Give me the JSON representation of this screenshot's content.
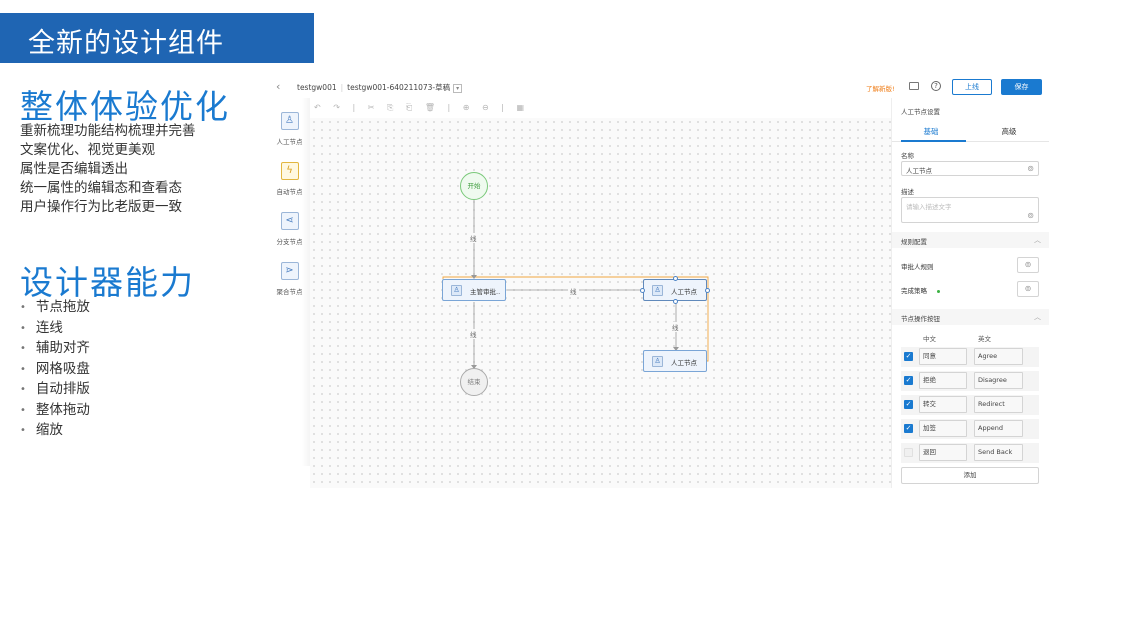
{
  "banner": {
    "title": "全新的设计组件"
  },
  "section1": {
    "heading": "整体体验优化",
    "lines": [
      "重新梳理功能结构梳理并完善",
      "文案优化、视觉更美观",
      "属性是否编辑透出",
      "统一属性的编辑态和查看态",
      "用户操作行为比老版更一致"
    ]
  },
  "section2": {
    "heading": "设计器能力",
    "bullets": [
      "节点拖放",
      "连线",
      "辅助对齐",
      "网格吸盘",
      "自动排版",
      "整体拖动",
      "缩放"
    ]
  },
  "app": {
    "breadcrumb": {
      "project": "testgw001",
      "flow": "testgw001-640211073-草稿"
    },
    "learn_new": "了解新版!",
    "online_label": "上线",
    "save_label": "保存",
    "palette": [
      {
        "label": "人工节点",
        "icon": "person-icon",
        "glyph": "♙"
      },
      {
        "label": "自动节点",
        "icon": "lightning-icon",
        "glyph": "⚡"
      },
      {
        "label": "分支节点",
        "icon": "branch-icon",
        "glyph": "⊰"
      },
      {
        "label": "聚合节点",
        "icon": "merge-icon",
        "glyph": "⊱"
      }
    ],
    "canvas_toolbar": "↶ ↷ | ✂ ⎘ ⎗ 🗑 | ⊕ ⊖ | ▦",
    "nodes": {
      "start": "开始",
      "end": "结束",
      "manager": "主管审批..",
      "manual1": "人工节点",
      "manual2": "人工节点"
    },
    "edge_label": "线",
    "panel": {
      "title": "人工节点设置",
      "tabs": [
        "基础",
        "高级"
      ],
      "name_label": "名称",
      "name_value": "人工节点",
      "desc_label": "描述",
      "desc_placeholder": "请输入描述文字",
      "rule_section": "规则配置",
      "approver_rule": "审批人规则",
      "complete_strategy": "完成策略",
      "ops_section": "节点操作按钮",
      "col_zh": "中文",
      "col_en": "英文",
      "ops": [
        {
          "zh": "同意",
          "en": "Agree",
          "checked": true
        },
        {
          "zh": "拒绝",
          "en": "Disagree",
          "checked": true
        },
        {
          "zh": "转交",
          "en": "Redirect",
          "checked": true
        },
        {
          "zh": "加签",
          "en": "Append",
          "checked": true
        },
        {
          "zh": "退回",
          "en": "Send Back",
          "checked": false
        }
      ],
      "add_label": "添加"
    }
  }
}
